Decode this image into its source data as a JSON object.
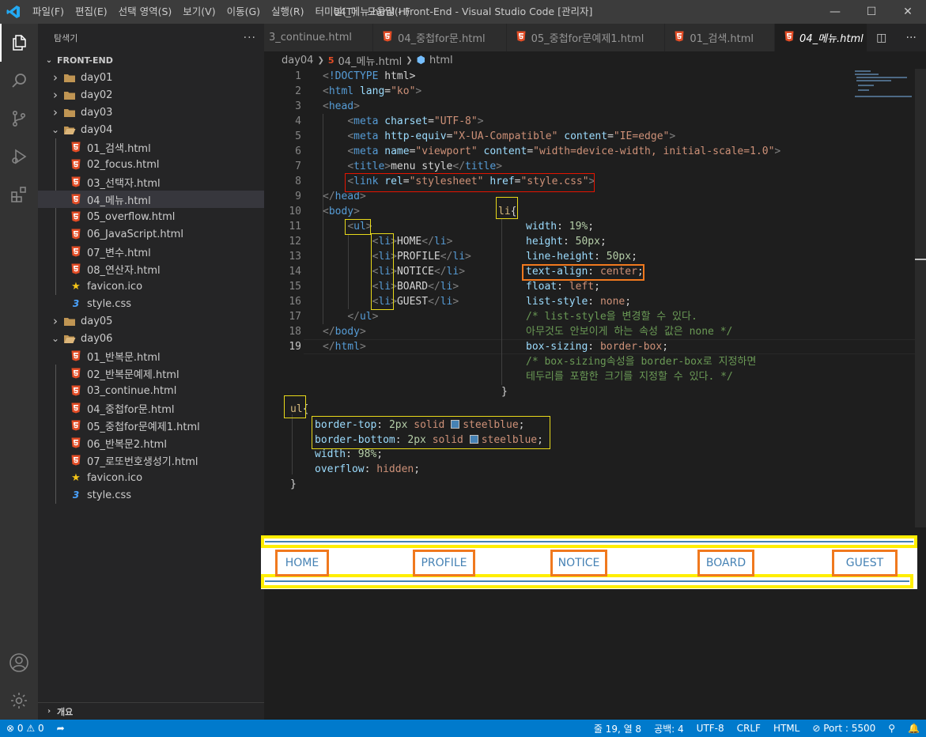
{
  "titlebar": {
    "menus": [
      "파일(F)",
      "편집(E)",
      "선택 영역(S)",
      "보기(V)",
      "이동(G)",
      "실행(R)",
      "터미널(T)",
      "도움말(H)"
    ],
    "title": "04_메뉴.html - Front-End - Visual Studio Code [관리자]"
  },
  "sidebar": {
    "title": "탐색기",
    "root": "FRONT-END",
    "items": [
      {
        "label": "day01",
        "type": "folder",
        "open": false,
        "depth": 0
      },
      {
        "label": "day02",
        "type": "folder",
        "open": false,
        "depth": 0
      },
      {
        "label": "day03",
        "type": "folder",
        "open": false,
        "depth": 0
      },
      {
        "label": "day04",
        "type": "folder",
        "open": true,
        "depth": 0
      },
      {
        "label": "01_검색.html",
        "type": "html",
        "depth": 1
      },
      {
        "label": "02_focus.html",
        "type": "html",
        "depth": 1
      },
      {
        "label": "03_선택자.html",
        "type": "html",
        "depth": 1
      },
      {
        "label": "04_메뉴.html",
        "type": "html",
        "depth": 1,
        "selected": true
      },
      {
        "label": "05_overflow.html",
        "type": "html",
        "depth": 1
      },
      {
        "label": "06_JavaScript.html",
        "type": "html",
        "depth": 1
      },
      {
        "label": "07_변수.html",
        "type": "html",
        "depth": 1
      },
      {
        "label": "08_연산자.html",
        "type": "html",
        "depth": 1
      },
      {
        "label": "favicon.ico",
        "type": "ico",
        "depth": 1
      },
      {
        "label": "style.css",
        "type": "css",
        "depth": 1
      },
      {
        "label": "day05",
        "type": "folder",
        "open": false,
        "depth": 0
      },
      {
        "label": "day06",
        "type": "folder",
        "open": true,
        "depth": 0
      },
      {
        "label": "01_반복문.html",
        "type": "html",
        "depth": 1
      },
      {
        "label": "02_반복문예제.html",
        "type": "html",
        "depth": 1
      },
      {
        "label": "03_continue.html",
        "type": "html",
        "depth": 1
      },
      {
        "label": "04_중첩for문.html",
        "type": "html",
        "depth": 1
      },
      {
        "label": "05_중첩for문예제1.html",
        "type": "html",
        "depth": 1
      },
      {
        "label": "06_반복문2.html",
        "type": "html",
        "depth": 1
      },
      {
        "label": "07_로또번호생성기.html",
        "type": "html",
        "depth": 1
      },
      {
        "label": "favicon.ico",
        "type": "ico",
        "depth": 1
      },
      {
        "label": "style.css",
        "type": "css",
        "depth": 1
      }
    ],
    "outline": "개요"
  },
  "tabs": [
    {
      "label": "3_continue.html",
      "active": false
    },
    {
      "label": "04_중첩for문.html",
      "active": false
    },
    {
      "label": "05_중첩for문예제1.html",
      "active": false
    },
    {
      "label": "01_검색.html",
      "active": false
    },
    {
      "label": "04_메뉴.html",
      "active": true
    }
  ],
  "breadcrumb": [
    "day04",
    "04_메뉴.html",
    "html"
  ],
  "code_lines": [
    "<!DOCTYPE html>",
    "<html lang=\"ko\">",
    "<head>",
    "    <meta charset=\"UTF-8\">",
    "    <meta http-equiv=\"X-UA-Compatible\" content=\"IE=edge\">",
    "    <meta name=\"viewport\" content=\"width=device-width, initial-scale=1.0\">",
    "    <title>menu style</title>",
    "    <link rel=\"stylesheet\" href=\"style.css\">",
    "</head>",
    "<body>",
    "    <ul>",
    "        <li>HOME</li>",
    "        <li>PROFILE</li>",
    "        <li>NOTICE</li>",
    "        <li>BOARD</li>",
    "        <li>GUEST</li>",
    "    </ul>",
    "</body>",
    "</html>"
  ],
  "line_numbers": [
    "1",
    "2",
    "3",
    "4",
    "5",
    "6",
    "7",
    "8",
    "9",
    "10",
    "11",
    "12",
    "13",
    "14",
    "15",
    "16",
    "17",
    "18",
    "19"
  ],
  "css_li": {
    "selector": "li",
    "lines": [
      {
        "prop": "width",
        "val": "19%",
        "kind": "num"
      },
      {
        "prop": "height",
        "val": "50px",
        "kind": "num"
      },
      {
        "prop": "line-height",
        "val": "50px",
        "kind": "num"
      },
      {
        "prop": "text-align",
        "val": "center",
        "kind": "val"
      },
      {
        "prop": "float",
        "val": "left",
        "kind": "val"
      },
      {
        "prop": "list-style",
        "val": "none",
        "kind": "val"
      }
    ],
    "comment1": "/* list-style을 변경할 수 있다.",
    "comment2": "아무것도 안보이게 하는 속성 값은 none */",
    "box_sizing": {
      "prop": "box-sizing",
      "val": "border-box"
    },
    "comment3": "/* box-sizing속성을 border-box로 지정하면",
    "comment4": "테두리를 포함한 크기를 지정할 수 있다. */"
  },
  "css_ul": {
    "selector": "ul",
    "border_top": {
      "prop": "border-top",
      "num": "2px",
      "val": "solid",
      "color": "steelblue"
    },
    "border_bottom": {
      "prop": "border-bottom",
      "num": "2px",
      "val": "solid",
      "color": "steelblue"
    },
    "width": {
      "prop": "width",
      "val": "98%"
    },
    "overflow": {
      "prop": "overflow",
      "val": "hidden"
    }
  },
  "preview": {
    "items": [
      "HOME",
      "PROFILE",
      "NOTICE",
      "BOARD",
      "GUEST"
    ],
    "border_color": "#4682b4",
    "highlight_color": "#f0791e",
    "frame_color": "#ffee00"
  },
  "statusbar": {
    "errors": "0",
    "warnings": "0",
    "position": "줄 19, 열 8",
    "spaces": "공백: 4",
    "encoding": "UTF-8",
    "eol": "CRLF",
    "language": "HTML",
    "port": "Port : 5500"
  }
}
